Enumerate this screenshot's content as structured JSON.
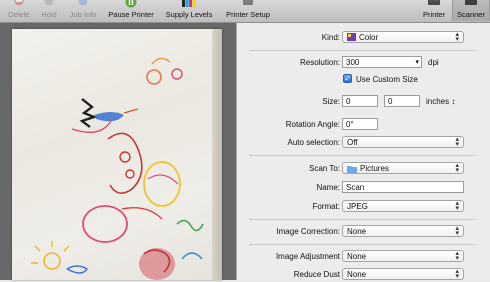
{
  "toolbar": {
    "delete_label": "Delete",
    "hold_label": "Hold",
    "job_info_label": "Job Info",
    "pause_printer_label": "Pause Printer",
    "supply_levels_label": "Supply Levels",
    "printer_setup_label": "Printer Setup",
    "printer_tab_label": "Printer",
    "scanner_tab_label": "Scanner"
  },
  "settings": {
    "kind": {
      "label": "Kind:",
      "value": "Color"
    },
    "resolution": {
      "label": "Resolution:",
      "value": "300",
      "unit": "dpi"
    },
    "custom_size": {
      "label": "Use Custom Size",
      "checked": true
    },
    "size": {
      "label": "Size:",
      "width": "0",
      "height": "0",
      "unit": "inches"
    },
    "rotation": {
      "label": "Rotation Angle:",
      "value": "0°"
    },
    "auto_selection": {
      "label": "Auto selection:",
      "value": "Off"
    },
    "scan_to": {
      "label": "Scan To:",
      "value": "Pictures"
    },
    "name": {
      "label": "Name:",
      "value": "Scan"
    },
    "format": {
      "label": "Format:",
      "value": "JPEG"
    },
    "image_correction": {
      "label": "Image Correction:",
      "value": "None"
    },
    "image_adjustment": {
      "label": "Image Adjustment",
      "value": "None"
    },
    "reduce_dust": {
      "label": "Reduce Dust",
      "value": "None"
    }
  },
  "colors": {
    "selected_tab": "#a9a9a9",
    "checkbox_blue": "#2f6fd0",
    "preview_bg": "#686868"
  },
  "icons": {
    "delete": "no-entry-icon",
    "hold": "hold-icon",
    "job_info": "info-icon",
    "pause_printer": "pause-icon",
    "supply_levels": "ink-levels-icon",
    "printer_setup": "printer-setup-icon",
    "printer_tab": "printer-icon",
    "scanner_tab": "scanner-icon",
    "kind_swatch": "color-swatch-icon",
    "folder": "folder-icon"
  }
}
